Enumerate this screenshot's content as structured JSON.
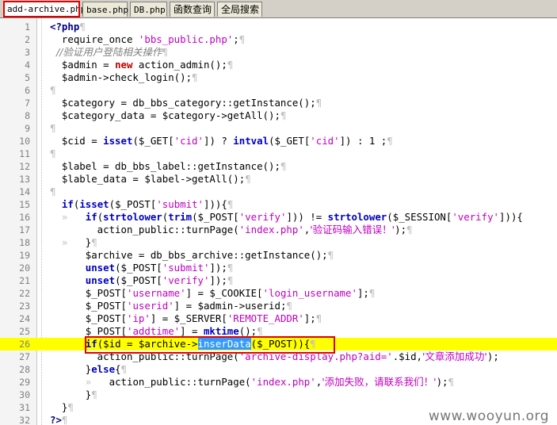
{
  "tabs": [
    {
      "label": "add-archive.php",
      "active": true
    },
    {
      "label": "base.php",
      "active": false
    },
    {
      "label": "DB.php",
      "active": false
    },
    {
      "label": "函数查询",
      "active": false
    },
    {
      "label": "全局搜索",
      "active": false
    }
  ],
  "lines": [
    {
      "n": "1",
      "tokens": [
        {
          "t": "<?php",
          "c": "php"
        },
        {
          "t": "¶",
          "c": "mk"
        }
      ]
    },
    {
      "n": "2",
      "tokens": [
        {
          "t": "  require_once ",
          "c": "pl"
        },
        {
          "t": "'bbs_public.php'",
          "c": "str"
        },
        {
          "t": ";",
          "c": "pl"
        },
        {
          "t": "¶",
          "c": "mk"
        }
      ]
    },
    {
      "n": "3",
      "tokens": [
        {
          "t": "  //验证用户登陆相关操作",
          "c": "cmt"
        },
        {
          "t": "¶",
          "c": "mk"
        }
      ]
    },
    {
      "n": "4",
      "tokens": [
        {
          "t": "  $admin = ",
          "c": "pl"
        },
        {
          "t": "new",
          "c": "kwnew"
        },
        {
          "t": " action_admin();",
          "c": "pl"
        },
        {
          "t": "¶",
          "c": "mk"
        }
      ]
    },
    {
      "n": "5",
      "tokens": [
        {
          "t": "  $admin->check_login();",
          "c": "pl"
        },
        {
          "t": "¶",
          "c": "mk"
        }
      ]
    },
    {
      "n": "6",
      "tokens": [
        {
          "t": "¶",
          "c": "mk"
        }
      ]
    },
    {
      "n": "7",
      "tokens": [
        {
          "t": "  $category = db_bbs_category::getInstance();",
          "c": "pl"
        },
        {
          "t": "¶",
          "c": "mk"
        }
      ]
    },
    {
      "n": "8",
      "tokens": [
        {
          "t": "  $category_data = $category->getAll();",
          "c": "pl"
        },
        {
          "t": "¶",
          "c": "mk"
        }
      ]
    },
    {
      "n": "9",
      "tokens": [
        {
          "t": "¶",
          "c": "mk"
        }
      ]
    },
    {
      "n": "10",
      "tokens": [
        {
          "t": "  $cid = ",
          "c": "pl"
        },
        {
          "t": "isset",
          "c": "kw"
        },
        {
          "t": "($_GET[",
          "c": "pl"
        },
        {
          "t": "'cid'",
          "c": "str"
        },
        {
          "t": "]) ? ",
          "c": "pl"
        },
        {
          "t": "intval",
          "c": "kw"
        },
        {
          "t": "($_GET[",
          "c": "pl"
        },
        {
          "t": "'cid'",
          "c": "str"
        },
        {
          "t": "]) : 1 ;",
          "c": "pl"
        },
        {
          "t": "¶",
          "c": "mk"
        }
      ]
    },
    {
      "n": "11",
      "tokens": [
        {
          "t": "¶",
          "c": "mk"
        }
      ]
    },
    {
      "n": "12",
      "tokens": [
        {
          "t": "  $label = db_bbs_label::getInstance();",
          "c": "pl"
        },
        {
          "t": "¶",
          "c": "mk"
        }
      ]
    },
    {
      "n": "13",
      "tokens": [
        {
          "t": "  $lable_data = $label->getAll();",
          "c": "pl"
        },
        {
          "t": "¶",
          "c": "mk"
        }
      ]
    },
    {
      "n": "14",
      "tokens": [
        {
          "t": "¶",
          "c": "mk"
        }
      ]
    },
    {
      "n": "15",
      "tokens": [
        {
          "t": "  ",
          "c": "pl"
        },
        {
          "t": "if",
          "c": "kw"
        },
        {
          "t": "(",
          "c": "pl"
        },
        {
          "t": "isset",
          "c": "kw"
        },
        {
          "t": "($_POST[",
          "c": "pl"
        },
        {
          "t": "'submit'",
          "c": "str"
        },
        {
          "t": "])){",
          "c": "pl"
        },
        {
          "t": "¶",
          "c": "mk"
        }
      ]
    },
    {
      "n": "16",
      "tokens": [
        {
          "t": "  »   ",
          "c": "mk"
        },
        {
          "t": "if",
          "c": "kw"
        },
        {
          "t": "(",
          "c": "pl"
        },
        {
          "t": "strtolower",
          "c": "kw"
        },
        {
          "t": "(",
          "c": "pl"
        },
        {
          "t": "trim",
          "c": "kw"
        },
        {
          "t": "($_POST[",
          "c": "pl"
        },
        {
          "t": "'verify'",
          "c": "str"
        },
        {
          "t": "])) != ",
          "c": "pl"
        },
        {
          "t": "strtolower",
          "c": "kw"
        },
        {
          "t": "($_SESSION[",
          "c": "pl"
        },
        {
          "t": "'verify'",
          "c": "str"
        },
        {
          "t": "])){",
          "c": "pl"
        }
      ]
    },
    {
      "n": "17",
      "tokens": [
        {
          "t": "        action_public::turnPage(",
          "c": "pl"
        },
        {
          "t": "'index.php'",
          "c": "str"
        },
        {
          "t": ",",
          "c": "pl"
        },
        {
          "t": "'验证码输入错误！'",
          "c": "str"
        },
        {
          "t": ");",
          "c": "pl"
        },
        {
          "t": "¶",
          "c": "mk"
        }
      ]
    },
    {
      "n": "18",
      "tokens": [
        {
          "t": "  »   ",
          "c": "mk"
        },
        {
          "t": "}",
          "c": "pl"
        },
        {
          "t": "¶",
          "c": "mk"
        }
      ]
    },
    {
      "n": "19",
      "tokens": [
        {
          "t": "      $archive = db_bbs_archive::getInstance();",
          "c": "pl"
        },
        {
          "t": "¶",
          "c": "mk"
        }
      ]
    },
    {
      "n": "20",
      "tokens": [
        {
          "t": "      ",
          "c": "pl"
        },
        {
          "t": "unset",
          "c": "kw"
        },
        {
          "t": "($_POST[",
          "c": "pl"
        },
        {
          "t": "'submit'",
          "c": "str"
        },
        {
          "t": "]);",
          "c": "pl"
        },
        {
          "t": "¶",
          "c": "mk"
        }
      ]
    },
    {
      "n": "21",
      "tokens": [
        {
          "t": "      ",
          "c": "pl"
        },
        {
          "t": "unset",
          "c": "kw"
        },
        {
          "t": "($_POST[",
          "c": "pl"
        },
        {
          "t": "'verify'",
          "c": "str"
        },
        {
          "t": "]);",
          "c": "pl"
        },
        {
          "t": "¶",
          "c": "mk"
        }
      ]
    },
    {
      "n": "22",
      "tokens": [
        {
          "t": "      $_POST[",
          "c": "pl"
        },
        {
          "t": "'username'",
          "c": "str"
        },
        {
          "t": "] = $_COOKIE[",
          "c": "pl"
        },
        {
          "t": "'login_username'",
          "c": "str"
        },
        {
          "t": "];",
          "c": "pl"
        },
        {
          "t": "¶",
          "c": "mk"
        }
      ]
    },
    {
      "n": "23",
      "tokens": [
        {
          "t": "      $_POST[",
          "c": "pl"
        },
        {
          "t": "'userid'",
          "c": "str"
        },
        {
          "t": "] = $admin->userid;",
          "c": "pl"
        },
        {
          "t": "¶",
          "c": "mk"
        }
      ]
    },
    {
      "n": "24",
      "tokens": [
        {
          "t": "      $_POST[",
          "c": "pl"
        },
        {
          "t": "'ip'",
          "c": "str"
        },
        {
          "t": "] = $_SERVER[",
          "c": "pl"
        },
        {
          "t": "'REMOTE_ADDR'",
          "c": "str"
        },
        {
          "t": "];",
          "c": "pl"
        },
        {
          "t": "¶",
          "c": "mk"
        }
      ]
    },
    {
      "n": "25",
      "tokens": [
        {
          "t": "      $_POST[",
          "c": "pl"
        },
        {
          "t": "'addtime'",
          "c": "str"
        },
        {
          "t": "] = ",
          "c": "pl"
        },
        {
          "t": "mktime",
          "c": "kw"
        },
        {
          "t": "();",
          "c": "pl"
        },
        {
          "t": "¶",
          "c": "mk"
        }
      ]
    },
    {
      "n": "26",
      "current": true,
      "tokens": [
        {
          "t": "      ",
          "c": "pl"
        },
        {
          "t": "if",
          "c": "kw"
        },
        {
          "t": "($id = $archive->",
          "c": "pl"
        },
        {
          "t": "inserData",
          "c": "sel"
        },
        {
          "t": "($_POST)){",
          "c": "pl"
        },
        {
          "t": "¶",
          "c": "mk"
        }
      ]
    },
    {
      "n": "27",
      "tokens": [
        {
          "t": "        action_public::turnPage(",
          "c": "pl"
        },
        {
          "t": "'archive-display.php?aid='",
          "c": "str"
        },
        {
          "t": ".$id,",
          "c": "pl"
        },
        {
          "t": "'文章添加成功'",
          "c": "str"
        },
        {
          "t": ");",
          "c": "pl"
        }
      ]
    },
    {
      "n": "28",
      "tokens": [
        {
          "t": "      }",
          "c": "pl"
        },
        {
          "t": "else",
          "c": "kw"
        },
        {
          "t": "{",
          "c": "pl"
        },
        {
          "t": "¶",
          "c": "mk"
        }
      ]
    },
    {
      "n": "29",
      "tokens": [
        {
          "t": "      »   ",
          "c": "mk"
        },
        {
          "t": "action_public::turnPage(",
          "c": "pl"
        },
        {
          "t": "'index.php'",
          "c": "str"
        },
        {
          "t": ",",
          "c": "pl"
        },
        {
          "t": "'添加失败，请联系我们！'",
          "c": "str"
        },
        {
          "t": ");",
          "c": "pl"
        },
        {
          "t": "¶",
          "c": "mk"
        }
      ]
    },
    {
      "n": "30",
      "tokens": [
        {
          "t": "      }",
          "c": "pl"
        },
        {
          "t": "¶",
          "c": "mk"
        }
      ]
    },
    {
      "n": "31",
      "tokens": [
        {
          "t": "  }",
          "c": "pl"
        },
        {
          "t": "¶",
          "c": "mk"
        }
      ]
    },
    {
      "n": "32",
      "tokens": [
        {
          "t": "?>",
          "c": "php"
        },
        {
          "t": "¶",
          "c": "mk"
        }
      ]
    }
  ],
  "watermark": "www.wooyun.org",
  "colors": {
    "current_line": "#ffff00",
    "annotation_box": "#e00000",
    "selection": "#3399ff",
    "string": "#c000c0",
    "keyword": "#0000c0"
  }
}
